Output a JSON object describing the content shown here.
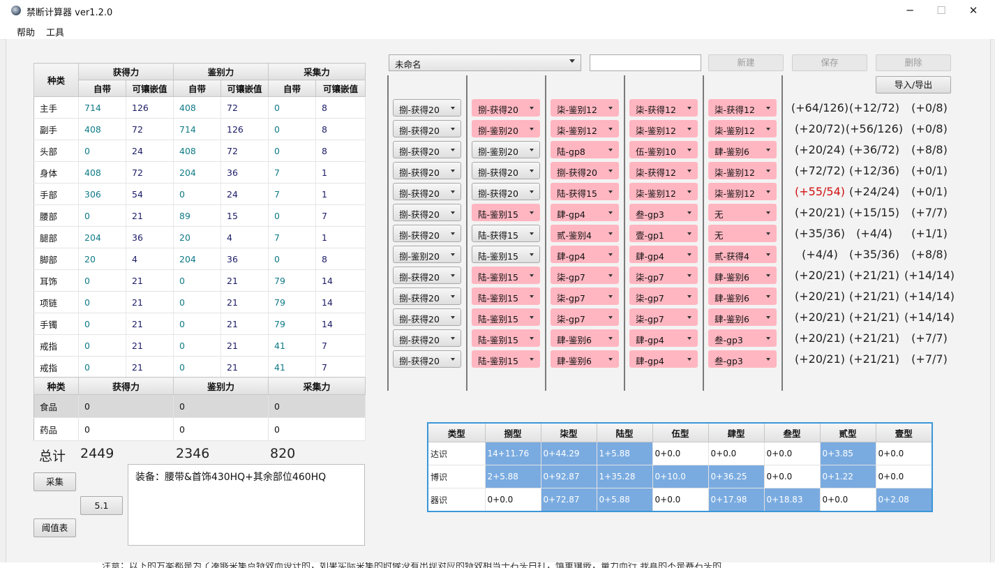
{
  "window": {
    "title": "禁断计算器 ver1.2.0",
    "controls": [
      "─",
      "☐",
      "✕"
    ]
  },
  "menu": [
    "帮助",
    "工具"
  ],
  "gear_table": {
    "col_kind": "种类",
    "groups": [
      "获得力",
      "鉴别力",
      "采集力"
    ],
    "subheaders": [
      "自带",
      "可镶嵌值",
      "自带",
      "可镶嵌值",
      "自带",
      "可镶嵌值"
    ],
    "rows": [
      {
        "slot": "主手",
        "v": [
          "714",
          "126",
          "408",
          "72",
          "0",
          "8"
        ]
      },
      {
        "slot": "副手",
        "v": [
          "408",
          "72",
          "714",
          "126",
          "0",
          "8"
        ]
      },
      {
        "slot": "头部",
        "v": [
          "0",
          "24",
          "408",
          "72",
          "0",
          "8"
        ]
      },
      {
        "slot": "身体",
        "v": [
          "408",
          "72",
          "204",
          "36",
          "7",
          "1"
        ]
      },
      {
        "slot": "手部",
        "v": [
          "306",
          "54",
          "0",
          "24",
          "7",
          "1"
        ]
      },
      {
        "slot": "腰部",
        "v": [
          "0",
          "21",
          "89",
          "15",
          "0",
          "7"
        ]
      },
      {
        "slot": "腿部",
        "v": [
          "204",
          "36",
          "20",
          "4",
          "7",
          "1"
        ]
      },
      {
        "slot": "脚部",
        "v": [
          "20",
          "4",
          "204",
          "36",
          "0",
          "8"
        ]
      },
      {
        "slot": "耳饰",
        "v": [
          "0",
          "21",
          "0",
          "21",
          "79",
          "14"
        ]
      },
      {
        "slot": "项链",
        "v": [
          "0",
          "21",
          "0",
          "21",
          "79",
          "14"
        ]
      },
      {
        "slot": "手镯",
        "v": [
          "0",
          "21",
          "0",
          "21",
          "79",
          "14"
        ]
      },
      {
        "slot": "戒指",
        "v": [
          "0",
          "21",
          "0",
          "21",
          "41",
          "7"
        ]
      },
      {
        "slot": "戒指",
        "v": [
          "0",
          "21",
          "0",
          "21",
          "41",
          "7"
        ]
      }
    ]
  },
  "consumables": {
    "headers": [
      "种类",
      "获得力",
      "鉴别力",
      "采集力"
    ],
    "rows": [
      {
        "kind": "食品",
        "v": [
          "0",
          "0",
          "0"
        ]
      },
      {
        "kind": "药品",
        "v": [
          "0",
          "0",
          "0"
        ]
      }
    ]
  },
  "totals": {
    "label": "总计",
    "gathering": "2449",
    "perception": "2346",
    "gp": "820"
  },
  "buttons": {
    "gather": "采集",
    "version": "5.1",
    "threshold": "阈值表",
    "new": "新建",
    "save": "保存",
    "delete": "删除",
    "import_export": "导入/导出"
  },
  "notes": "装备：腰带&首饰430HQ+其余部位460HQ",
  "profile": {
    "selected": "未命名",
    "name_value": ""
  },
  "meld_grid": [
    {
      "m": [
        [
          "捌-获得20",
          "g"
        ],
        [
          "捌-获得20",
          "p"
        ],
        [
          "柒-鉴别12",
          "p"
        ],
        [
          "柒-获得12",
          "p"
        ],
        [
          "柒-获得12",
          "p"
        ]
      ],
      "r": [
        "(+64/126)",
        "(+12/72)",
        "(+0/8)"
      ],
      "red": [
        false,
        false,
        false
      ]
    },
    {
      "m": [
        [
          "捌-获得20",
          "g"
        ],
        [
          "捌-鉴别20",
          "p"
        ],
        [
          "柒-鉴别12",
          "p"
        ],
        [
          "柒-鉴别12",
          "p"
        ],
        [
          "柒-鉴别12",
          "p"
        ]
      ],
      "r": [
        "(+20/72)",
        "(+56/126)",
        "(+0/8)"
      ],
      "red": [
        false,
        false,
        false
      ]
    },
    {
      "m": [
        [
          "捌-获得20",
          "g"
        ],
        [
          "捌-鉴别20",
          "g"
        ],
        [
          "陆-gp8",
          "p"
        ],
        [
          "伍-鉴别10",
          "p"
        ],
        [
          "肆-鉴别6",
          "p"
        ]
      ],
      "r": [
        "(+20/24)",
        "(+36/72)",
        "(+8/8)"
      ],
      "red": [
        false,
        false,
        false
      ]
    },
    {
      "m": [
        [
          "捌-获得20",
          "g"
        ],
        [
          "捌-获得20",
          "g"
        ],
        [
          "捌-获得20",
          "p"
        ],
        [
          "柒-获得12",
          "p"
        ],
        [
          "柒-鉴别12",
          "p"
        ]
      ],
      "r": [
        "(+72/72)",
        "(+12/36)",
        "(+0/1)"
      ],
      "red": [
        false,
        false,
        false
      ]
    },
    {
      "m": [
        [
          "捌-获得20",
          "g"
        ],
        [
          "捌-获得20",
          "g"
        ],
        [
          "陆-获得15",
          "p"
        ],
        [
          "柒-鉴别12",
          "p"
        ],
        [
          "柒-鉴别12",
          "p"
        ]
      ],
      "r": [
        "(+55/54)",
        "(+24/24)",
        "(+0/1)"
      ],
      "red": [
        true,
        false,
        false
      ]
    },
    {
      "m": [
        [
          "捌-获得20",
          "g"
        ],
        [
          "陆-鉴别15",
          "p"
        ],
        [
          "肆-gp4",
          "p"
        ],
        [
          "叁-gp3",
          "p"
        ],
        [
          "无",
          "p"
        ]
      ],
      "r": [
        "(+20/21)",
        "(+15/15)",
        "(+7/7)"
      ],
      "red": [
        false,
        false,
        false
      ]
    },
    {
      "m": [
        [
          "捌-获得20",
          "g"
        ],
        [
          "陆-获得15",
          "g"
        ],
        [
          "贰-鉴别4",
          "p"
        ],
        [
          "壹-gp1",
          "p"
        ],
        [
          "无",
          "p"
        ]
      ],
      "r": [
        "(+35/36)",
        "(+4/4)",
        "(+1/1)"
      ],
      "red": [
        false,
        false,
        false
      ]
    },
    {
      "m": [
        [
          "捌-鉴别20",
          "g"
        ],
        [
          "陆-鉴别15",
          "g"
        ],
        [
          "肆-gp4",
          "p"
        ],
        [
          "肆-gp4",
          "p"
        ],
        [
          "贰-获得4",
          "p"
        ]
      ],
      "r": [
        "(+4/4)",
        "(+35/36)",
        "(+8/8)"
      ],
      "red": [
        false,
        false,
        false
      ]
    },
    {
      "m": [
        [
          "捌-获得20",
          "g"
        ],
        [
          "陆-鉴别15",
          "p"
        ],
        [
          "柒-gp7",
          "p"
        ],
        [
          "柒-gp7",
          "p"
        ],
        [
          "肆-鉴别6",
          "p"
        ]
      ],
      "r": [
        "(+20/21)",
        "(+21/21)",
        "(+14/14)"
      ],
      "red": [
        false,
        false,
        false
      ]
    },
    {
      "m": [
        [
          "捌-获得20",
          "g"
        ],
        [
          "陆-鉴别15",
          "p"
        ],
        [
          "柒-gp7",
          "p"
        ],
        [
          "柒-gp7",
          "p"
        ],
        [
          "肆-鉴别6",
          "p"
        ]
      ],
      "r": [
        "(+20/21)",
        "(+21/21)",
        "(+14/14)"
      ],
      "red": [
        false,
        false,
        false
      ]
    },
    {
      "m": [
        [
          "捌-获得20",
          "g"
        ],
        [
          "陆-鉴别15",
          "p"
        ],
        [
          "柒-gp7",
          "p"
        ],
        [
          "柒-gp7",
          "p"
        ],
        [
          "肆-鉴别6",
          "p"
        ]
      ],
      "r": [
        "(+20/21)",
        "(+21/21)",
        "(+14/14)"
      ],
      "red": [
        false,
        false,
        false
      ]
    },
    {
      "m": [
        [
          "捌-获得20",
          "g"
        ],
        [
          "陆-鉴别15",
          "p"
        ],
        [
          "肆-鉴别6",
          "p"
        ],
        [
          "肆-gp4",
          "p"
        ],
        [
          "叁-gp3",
          "p"
        ]
      ],
      "r": [
        "(+20/21)",
        "(+21/21)",
        "(+7/7)"
      ],
      "red": [
        false,
        false,
        false
      ]
    },
    {
      "m": [
        [
          "捌-获得20",
          "g"
        ],
        [
          "陆-鉴别15",
          "p"
        ],
        [
          "肆-鉴别6",
          "p"
        ],
        [
          "肆-gp4",
          "p"
        ],
        [
          "叁-gp3",
          "p"
        ]
      ],
      "r": [
        "(+20/21)",
        "(+21/21)",
        "(+7/7)"
      ],
      "red": [
        false,
        false,
        false
      ]
    }
  ],
  "stats_table": {
    "headers": [
      "类型",
      "捌型",
      "柒型",
      "陆型",
      "伍型",
      "肆型",
      "叁型",
      "贰型",
      "壹型"
    ],
    "rows": [
      {
        "label": "达识",
        "cells": [
          [
            "14+11.76",
            true
          ],
          [
            "0+44.29",
            true
          ],
          [
            "1+5.88",
            true
          ],
          [
            "0+0.0",
            false
          ],
          [
            "0+0.0",
            false
          ],
          [
            "0+0.0",
            false
          ],
          [
            "0+3.85",
            true
          ],
          [
            "0+0.0",
            false
          ]
        ]
      },
      {
        "label": "博识",
        "cells": [
          [
            "2+5.88",
            true
          ],
          [
            "0+92.87",
            true
          ],
          [
            "1+35.28",
            true
          ],
          [
            "0+10.0",
            true
          ],
          [
            "0+36.25",
            true
          ],
          [
            "0+0.0",
            false
          ],
          [
            "0+1.22",
            true
          ],
          [
            "0+0.0",
            false
          ]
        ]
      },
      {
        "label": "器识",
        "cells": [
          [
            "0+0.0",
            false
          ],
          [
            "0+72.87",
            true
          ],
          [
            "0+5.88",
            true
          ],
          [
            "0+0.0",
            false
          ],
          [
            "0+17.98",
            true
          ],
          [
            "0+18.83",
            true
          ],
          [
            "0+0.0",
            false
          ],
          [
            "0+2.08",
            true
          ]
        ]
      }
    ]
  },
  "bottom_note": "注意：以下的方案都是为了凑够采集点特效而设计的，如果实际采集的时候没有出现对应的特效相当于石头白打，慎重镶嵌，量力而行 我真的不是赛石头的"
}
